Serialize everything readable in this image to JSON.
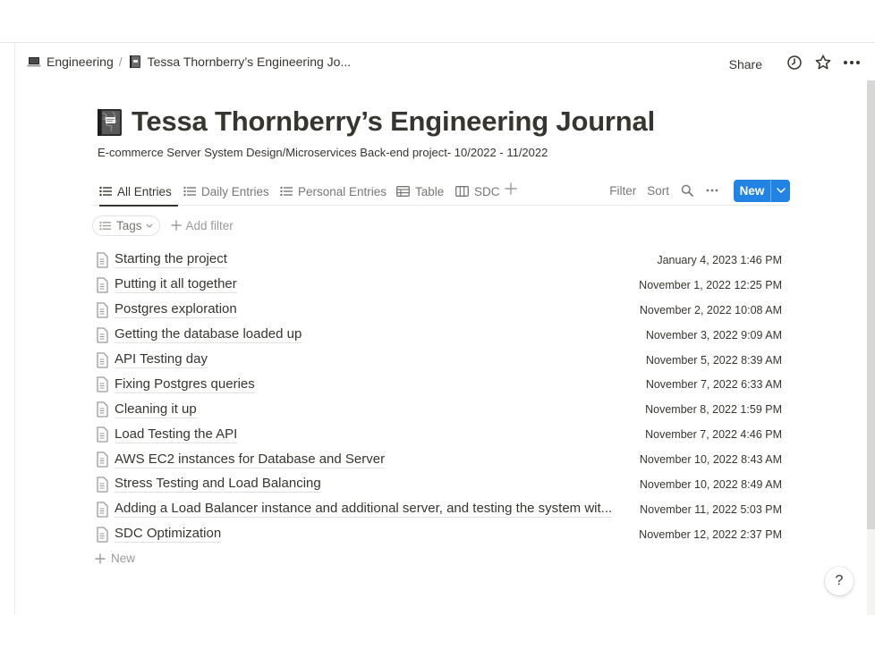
{
  "breadcrumb": {
    "workspace": "Engineering",
    "separator": "/",
    "page": "Tessa Thornberry’s Engineering Jo..."
  },
  "topbar": {
    "share_label": "Share",
    "icons": [
      "clock-icon",
      "star-icon",
      "more-icon"
    ]
  },
  "page": {
    "title": "Tessa Thornberry’s Engineering Journal",
    "description": "E-commerce Server System Design/Microservices Back-end project- 10/2022 - 11/2022"
  },
  "views": {
    "tabs": [
      {
        "label": "All Entries",
        "icon": "list-icon",
        "active": true
      },
      {
        "label": "Daily Entries",
        "icon": "list-icon",
        "active": false
      },
      {
        "label": "Personal Entries",
        "icon": "list-icon",
        "active": false
      },
      {
        "label": "Table",
        "icon": "table-icon",
        "active": false
      },
      {
        "label": "SDC",
        "icon": "board-icon",
        "active": false
      }
    ],
    "filter_label": "Filter",
    "sort_label": "Sort",
    "new_label": "New"
  },
  "filters": {
    "tags_label": "Tags",
    "add_filter_label": "Add filter"
  },
  "entries": [
    {
      "title": "Starting the project",
      "date": "January 4, 2023 1:46 PM"
    },
    {
      "title": "Putting it all together",
      "date": "November 1, 2022 12:25 PM"
    },
    {
      "title": "Postgres exploration",
      "date": "November 2, 2022 10:08 AM"
    },
    {
      "title": "Getting the database loaded up",
      "date": "November 3, 2022 9:09 AM"
    },
    {
      "title": "API Testing day",
      "date": "November 5, 2022 8:39 AM"
    },
    {
      "title": "Fixing Postgres queries",
      "date": "November 7, 2022 6:33 AM"
    },
    {
      "title": "Cleaning it up",
      "date": "November 8, 2022 1:59 PM"
    },
    {
      "title": "Load Testing the API",
      "date": "November 7, 2022 4:46 PM"
    },
    {
      "title": "AWS EC2 instances for Database and Server",
      "date": "November 10, 2022 8:43 AM"
    },
    {
      "title": "Stress Testing and Load Balancing",
      "date": "November 10, 2022 8:49 AM"
    },
    {
      "title": "Adding a Load Balancer instance and additional server, and testing the system wit...",
      "date": "November 11, 2022 5:03 PM"
    },
    {
      "title": "SDC Optimization",
      "date": "November 12, 2022 2:37 PM"
    }
  ],
  "list_footer": {
    "new_label": "New"
  },
  "help": {
    "label": "?"
  },
  "colors": {
    "accent": "#2383e2",
    "text": "#37352f",
    "muted": "#787774"
  }
}
